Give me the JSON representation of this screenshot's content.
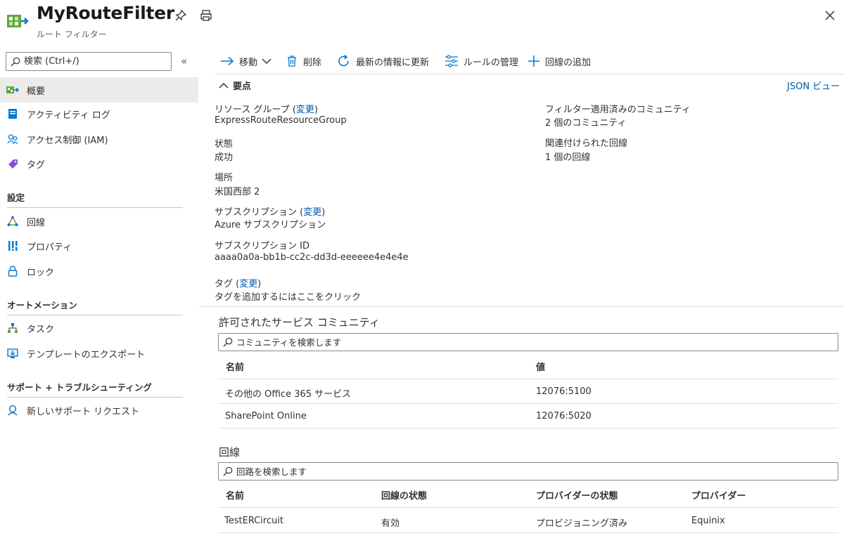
{
  "header": {
    "title": "MyRouteFilter",
    "subtitle": "ルート フィルター"
  },
  "sidebar": {
    "search_placeholder": "検索 (Ctrl+/)",
    "collapse_glyph": "«",
    "items": [
      {
        "label": "概要",
        "icon": "route-filter-icon"
      },
      {
        "label": "アクティビティ ログ",
        "icon": "activity-log-icon"
      },
      {
        "label": "アクセス制御 (IAM)",
        "icon": "iam-icon"
      },
      {
        "label": "タグ",
        "icon": "tag-icon"
      }
    ],
    "sections": [
      {
        "title": "設定",
        "items": [
          {
            "label": "回線",
            "icon": "circuit-icon"
          },
          {
            "label": "プロパティ",
            "icon": "properties-icon"
          },
          {
            "label": "ロック",
            "icon": "lock-icon"
          }
        ]
      },
      {
        "title": "オートメーション",
        "items": [
          {
            "label": "タスク",
            "icon": "tasks-icon"
          },
          {
            "label": "テンプレートのエクスポート",
            "icon": "export-template-icon"
          }
        ]
      },
      {
        "title": "サポート + トラブルシューティング",
        "items": [
          {
            "label": "新しいサポート リクエスト",
            "icon": "support-request-icon"
          }
        ]
      }
    ]
  },
  "toolbar": {
    "move": "移動",
    "delete": "削除",
    "refresh": "最新の情報に更新",
    "manage_rules": "ルールの管理",
    "add_circuit": "回線の追加"
  },
  "essentials": {
    "heading": "要点",
    "json_view": "JSON ビュー",
    "resource_group_label": "リソース グループ",
    "change": "変更",
    "resource_group_value": "ExpressRouteResourceGroup",
    "status_label": "状態",
    "status_value": "成功",
    "location_label": "場所",
    "location_value": "米国西部 2",
    "subscription_label": "サブスクリプション",
    "subscription_value": "Azure サブスクリプション",
    "subscription_id_label": "サブスクリプション ID",
    "subscription_id_value": "aaaa0a0a-bb1b-cc2c-dd3d-eeeeee4e4e4e",
    "tags_label": "タグ",
    "tags_value": "タグを追加するにはここをクリック",
    "communities_label": "フィルター適用済みのコミュニティ",
    "communities_value": "2 個のコミュニティ",
    "circuits_label": "関連付けられた回線",
    "circuits_value": "1 個の回線"
  },
  "communities": {
    "title": "許可されたサービス コミュニティ",
    "search_placeholder": "コミュニティを検索します",
    "columns": [
      "名前",
      "値"
    ],
    "rows": [
      [
        "その他の Office 365 サービス",
        "12076:5100"
      ],
      [
        "SharePoint Online",
        "12076:5020"
      ]
    ]
  },
  "circuits": {
    "title": "回線",
    "search_placeholder": "回路を検索します",
    "columns": [
      "名前",
      "回線の状態",
      "プロバイダーの状態",
      "プロバイダー"
    ],
    "rows": [
      [
        "TestERCircuit",
        "有効",
        "プロビジョニング済み",
        "Equinix"
      ]
    ]
  },
  "colors": {
    "link": "#0058ad",
    "accent": "#0078d4",
    "route_filter_green": "#5ea83e"
  }
}
